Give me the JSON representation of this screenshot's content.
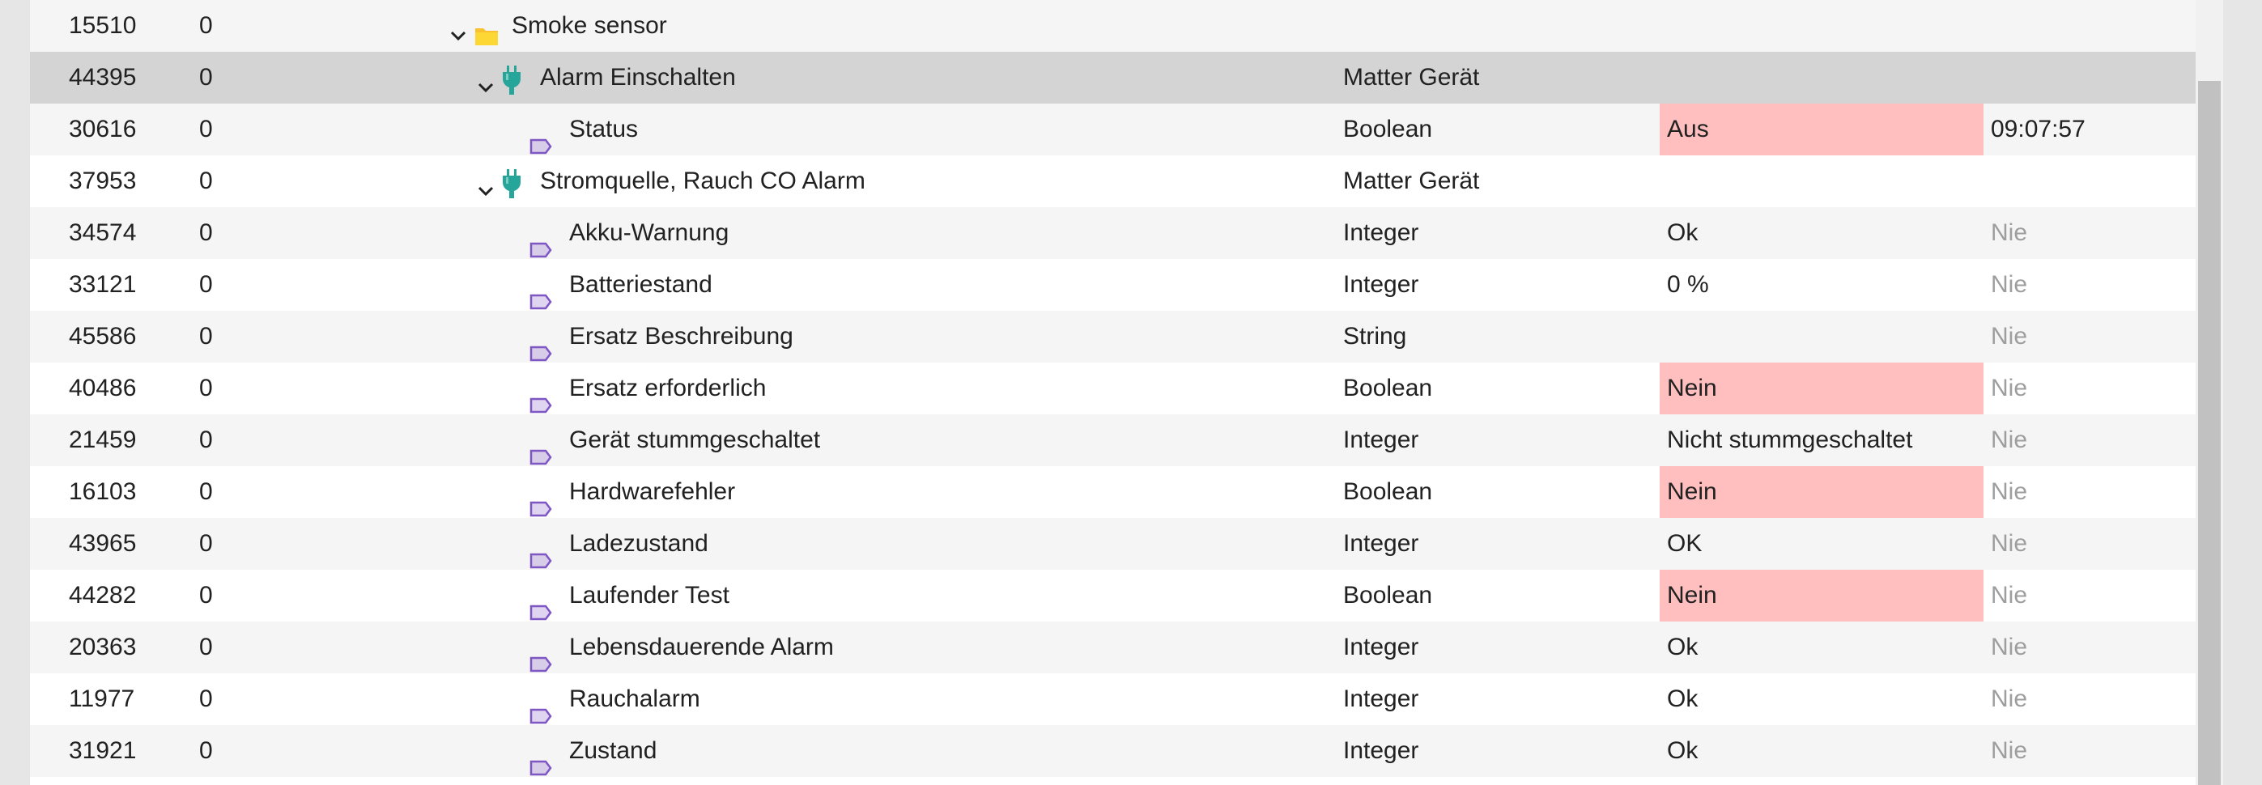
{
  "rows": [
    {
      "id": "15510",
      "ref": "0",
      "name": "Smoke sensor",
      "type": "",
      "value": "",
      "time": "",
      "icon": "folder-icon",
      "expanded": true,
      "level": 0
    },
    {
      "id": "44395",
      "ref": "0",
      "name": "Alarm Einschalten",
      "type": "Matter Gerät",
      "value": "",
      "time": "",
      "icon": "matter-device-icon",
      "expanded": true,
      "level": 1,
      "selected": true
    },
    {
      "id": "30616",
      "ref": "0",
      "name": "Status",
      "type": "Boolean",
      "value": "Aus",
      "time": "09:07:57",
      "icon": "state-tag-icon",
      "level": 2,
      "alert": true
    },
    {
      "id": "37953",
      "ref": "0",
      "name": "Stromquelle, Rauch CO Alarm",
      "type": "Matter Gerät",
      "value": "",
      "time": "",
      "icon": "matter-device-icon",
      "expanded": true,
      "level": 1
    },
    {
      "id": "34574",
      "ref": "0",
      "name": "Akku-Warnung",
      "type": "Integer",
      "value": "Ok",
      "time": "Nie",
      "icon": "state-tag-icon",
      "level": 2
    },
    {
      "id": "33121",
      "ref": "0",
      "name": "Batteriestand",
      "type": "Integer",
      "value": "0 %",
      "time": "Nie",
      "icon": "state-tag-icon",
      "level": 2
    },
    {
      "id": "45586",
      "ref": "0",
      "name": "Ersatz Beschreibung",
      "type": "String",
      "value": "",
      "time": "Nie",
      "icon": "state-tag-icon",
      "level": 2
    },
    {
      "id": "40486",
      "ref": "0",
      "name": "Ersatz erforderlich",
      "type": "Boolean",
      "value": "Nein",
      "time": "Nie",
      "icon": "state-tag-icon",
      "level": 2,
      "alert": true
    },
    {
      "id": "21459",
      "ref": "0",
      "name": "Gerät stummgeschaltet",
      "type": "Integer",
      "value": "Nicht stummgeschaltet",
      "time": "Nie",
      "icon": "state-tag-icon",
      "level": 2
    },
    {
      "id": "16103",
      "ref": "0",
      "name": "Hardwarefehler",
      "type": "Boolean",
      "value": "Nein",
      "time": "Nie",
      "icon": "state-tag-icon",
      "level": 2,
      "alert": true
    },
    {
      "id": "43965",
      "ref": "0",
      "name": "Ladezustand",
      "type": "Integer",
      "value": "OK",
      "time": "Nie",
      "icon": "state-tag-icon",
      "level": 2
    },
    {
      "id": "44282",
      "ref": "0",
      "name": "Laufender Test",
      "type": "Boolean",
      "value": "Nein",
      "time": "Nie",
      "icon": "state-tag-icon",
      "level": 2,
      "alert": true
    },
    {
      "id": "20363",
      "ref": "0",
      "name": "Lebensdauerende Alarm",
      "type": "Integer",
      "value": "Ok",
      "time": "Nie",
      "icon": "state-tag-icon",
      "level": 2
    },
    {
      "id": "11977",
      "ref": "0",
      "name": "Rauchalarm",
      "type": "Integer",
      "value": "Ok",
      "time": "Nie",
      "icon": "state-tag-icon",
      "level": 2
    },
    {
      "id": "31921",
      "ref": "0",
      "name": "Zustand",
      "type": "Integer",
      "value": "Ok",
      "time": "Nie",
      "icon": "state-tag-icon",
      "level": 2
    }
  ],
  "colors": {
    "alert_background": "#ffbfbf",
    "selected_row": "#d4d4d4",
    "muted_text": "#9e9e9e",
    "folder": "#fbc02d",
    "matter_device": "#26a69a",
    "state_tag": "#7e57c2"
  }
}
